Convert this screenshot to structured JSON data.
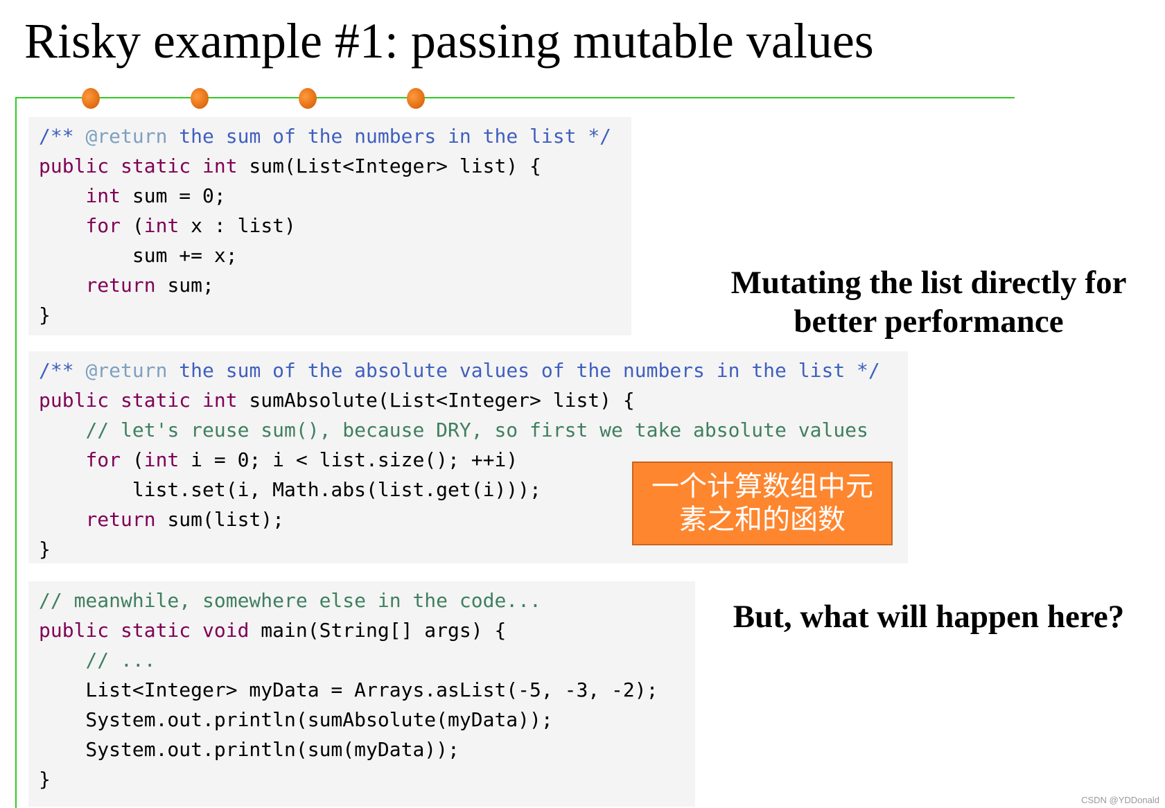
{
  "title": "Risky example #1: passing mutable values",
  "colors": {
    "accent_line": "#2ecc1f",
    "bullet": "#f07a1e",
    "keyword": "#7f0055",
    "javadoc": "#3f5fbf",
    "javadoc_tag": "#7f9fbf",
    "comment": "#3f7f5f",
    "code_bg": "#f4f4f4",
    "note_bg": "#fe862f"
  },
  "code_blocks": [
    {
      "lines": [
        [
          [
            "jd",
            "/** "
          ],
          [
            "tag",
            "@return"
          ],
          [
            "jd",
            " the sum of the numbers in the list */"
          ]
        ],
        [
          [
            "k",
            "public static int"
          ],
          [
            "p",
            " sum(List<Integer> list) {"
          ]
        ],
        [
          [
            "p",
            "    "
          ],
          [
            "k",
            "int"
          ],
          [
            "p",
            " sum = 0;"
          ]
        ],
        [
          [
            "p",
            "    "
          ],
          [
            "k",
            "for"
          ],
          [
            "p",
            " ("
          ],
          [
            "k",
            "int"
          ],
          [
            "p",
            " x : list)"
          ]
        ],
        [
          [
            "p",
            "        sum += x;"
          ]
        ],
        [
          [
            "p",
            "    "
          ],
          [
            "k",
            "return"
          ],
          [
            "p",
            " sum;"
          ]
        ],
        [
          [
            "p",
            "}"
          ]
        ]
      ]
    },
    {
      "lines": [
        [
          [
            "jd",
            "/** "
          ],
          [
            "tag",
            "@return"
          ],
          [
            "jd",
            " the sum of the absolute values of the numbers in the list */"
          ]
        ],
        [
          [
            "k",
            "public static int"
          ],
          [
            "p",
            " sumAbsolute(List<Integer> list) {"
          ]
        ],
        [
          [
            "p",
            "    "
          ],
          [
            "cm",
            "// let's reuse sum(), because DRY, so first we take absolute values"
          ]
        ],
        [
          [
            "p",
            "    "
          ],
          [
            "k",
            "for"
          ],
          [
            "p",
            " ("
          ],
          [
            "k",
            "int"
          ],
          [
            "p",
            " i = 0; i < list.size(); ++i)"
          ]
        ],
        [
          [
            "p",
            "        list.set(i, Math.abs(list.get(i)));"
          ]
        ],
        [
          [
            "p",
            "    "
          ],
          [
            "k",
            "return"
          ],
          [
            "p",
            " sum(list);"
          ]
        ],
        [
          [
            "p",
            "}"
          ]
        ]
      ]
    },
    {
      "lines": [
        [
          [
            "cm",
            "// meanwhile, somewhere else in the code..."
          ]
        ],
        [
          [
            "k",
            "public static void"
          ],
          [
            "p",
            " main(String[] args) {"
          ]
        ],
        [
          [
            "p",
            "    "
          ],
          [
            "cm",
            "// ..."
          ]
        ],
        [
          [
            "p",
            "    List<Integer> myData = Arrays.asList(-5, -3, -2);"
          ]
        ],
        [
          [
            "p",
            "    System.out.println(sumAbsolute(myData));"
          ]
        ],
        [
          [
            "p",
            "    System.out.println(sum(myData));"
          ]
        ],
        [
          [
            "p",
            "}"
          ]
        ]
      ]
    }
  ],
  "note": {
    "line1": "一个计算数组中元",
    "line2": "素之和的函数"
  },
  "side_text_1": {
    "line1": "Mutating the list directly for",
    "line2": "better performance"
  },
  "side_text_2": "But, what will happen here?",
  "watermark": "CSDN @YDDonald"
}
